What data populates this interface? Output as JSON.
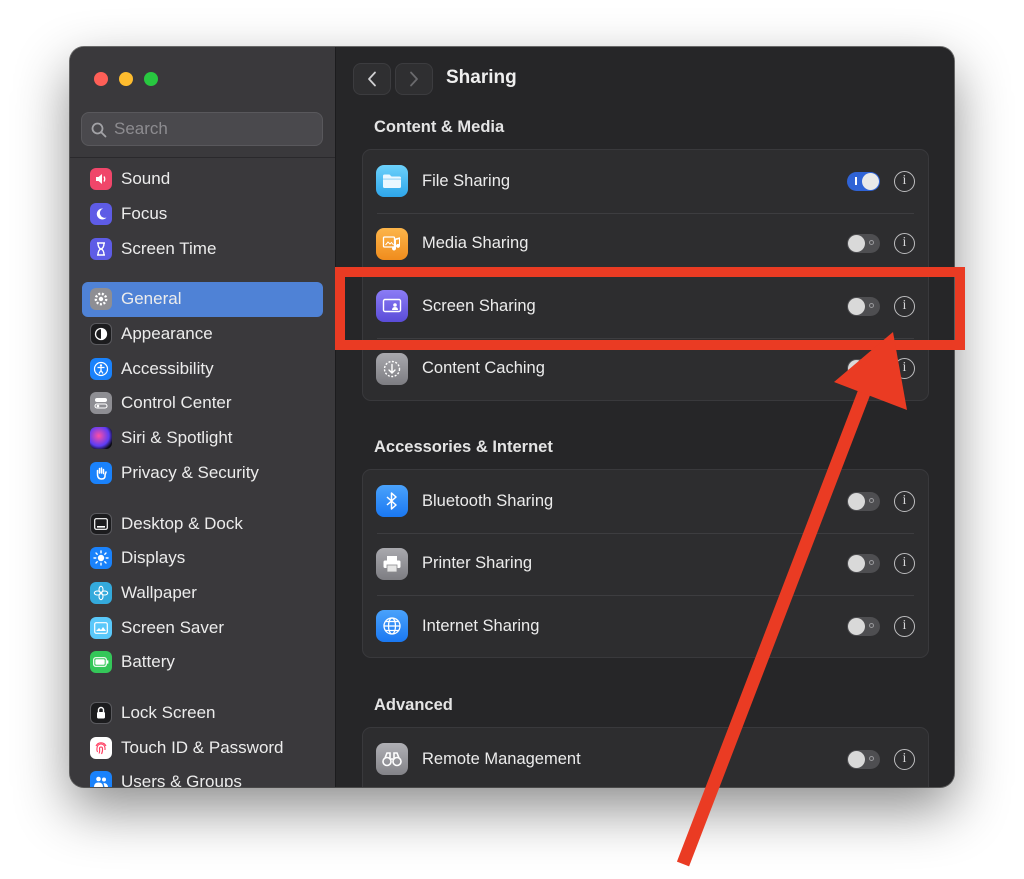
{
  "window": {
    "title": "Sharing"
  },
  "search": {
    "placeholder": "Search"
  },
  "sidebar": {
    "items": [
      {
        "label": "Sound",
        "icon": "speaker-icon",
        "color": "#f0466a"
      },
      {
        "label": "Focus",
        "icon": "moon-icon",
        "color": "#5e5ce6"
      },
      {
        "label": "Screen Time",
        "icon": "hourglass-icon",
        "color": "#5e5ce6"
      },
      {
        "label": "General",
        "icon": "gear-icon",
        "color": "#8e8e93",
        "active": true
      },
      {
        "label": "Appearance",
        "icon": "appearance-icon",
        "color": "#1c1c1e"
      },
      {
        "label": "Accessibility",
        "icon": "accessibility-icon",
        "color": "#1a82fb"
      },
      {
        "label": "Control Center",
        "icon": "switches-icon",
        "color": "#8e8e93"
      },
      {
        "label": "Siri & Spotlight",
        "icon": "siri-icon",
        "color": "#2b2b2e"
      },
      {
        "label": "Privacy & Security",
        "icon": "hand-icon",
        "color": "#1a82fb"
      },
      {
        "label": "Desktop & Dock",
        "icon": "dock-icon",
        "color": "#1c1c1e"
      },
      {
        "label": "Displays",
        "icon": "sun-icon",
        "color": "#1a82fb"
      },
      {
        "label": "Wallpaper",
        "icon": "flower-icon",
        "color": "#34aadc"
      },
      {
        "label": "Screen Saver",
        "icon": "screensaver-icon",
        "color": "#5ac8fa"
      },
      {
        "label": "Battery",
        "icon": "battery-icon",
        "color": "#34c759"
      },
      {
        "label": "Lock Screen",
        "icon": "lock-icon",
        "color": "#1c1c1e"
      },
      {
        "label": "Touch ID & Password",
        "icon": "fingerprint-icon",
        "color": "#ffffff"
      },
      {
        "label": "Users & Groups",
        "icon": "users-icon",
        "color": "#1a82fb"
      }
    ]
  },
  "main": {
    "sections": [
      {
        "title": "Content & Media",
        "rows": [
          {
            "label": "File Sharing",
            "icon": "folder-icon",
            "on": true
          },
          {
            "label": "Media Sharing",
            "icon": "media-icon",
            "on": false
          },
          {
            "label": "Screen Sharing",
            "icon": "screen-sharing-icon",
            "on": false
          },
          {
            "label": "Content Caching",
            "icon": "download-icon",
            "on": false
          }
        ]
      },
      {
        "title": "Accessories & Internet",
        "rows": [
          {
            "label": "Bluetooth Sharing",
            "icon": "bluetooth-icon",
            "on": false
          },
          {
            "label": "Printer Sharing",
            "icon": "printer-icon",
            "on": false
          },
          {
            "label": "Internet Sharing",
            "icon": "globe-icon",
            "on": false
          }
        ]
      },
      {
        "title": "Advanced",
        "rows": [
          {
            "label": "Remote Management",
            "icon": "binoculars-icon",
            "on": false
          }
        ]
      }
    ]
  },
  "colors": {
    "accent": "#4f82d6",
    "toggle_on": "#2f63d6",
    "annotation": "#ea3b23"
  }
}
